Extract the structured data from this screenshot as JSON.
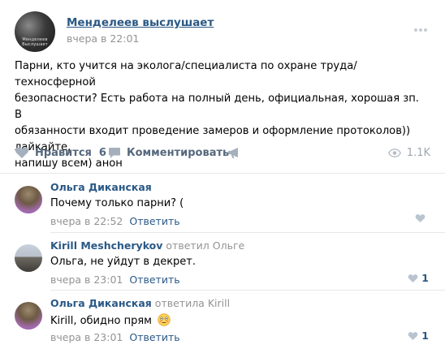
{
  "post": {
    "author": "Менделеев выслушает",
    "time": "вчера в 22:01",
    "avatar_text": "Менделеев Выслушает",
    "text": "Парни, кто учится на эколога/специалиста по охране труда/ техносферной\nбезопасности? Есть работа на полный день, официальная, хорошая зп. В\nобязанности входит проведение замеров и оформление протоколов)) лайкайте,\nнапишу всем) анон",
    "like_label": "Нравится",
    "like_count": "6",
    "comment_label": "Комментировать",
    "views": "1.1K"
  },
  "comments": [
    {
      "author": "Ольга Диканская",
      "replied_word": "",
      "reply_to": "",
      "text": "Почему только парни? (",
      "time": "вчера в 22:52",
      "reply_label": "Ответить",
      "likes": ""
    },
    {
      "author": "Kirill Meshcherykov",
      "replied_word": "ответил",
      "reply_to": "Ольге",
      "text": "Ольга, не уйдут в декрет.",
      "time": "вчера в 23:01",
      "reply_label": "Ответить",
      "likes": "1"
    },
    {
      "author": "Ольга Диканская",
      "replied_word": "ответила",
      "reply_to": "Kirill",
      "text": "Kirill, обидно прям",
      "time": "вчера в 23:01",
      "reply_label": "Ответить",
      "likes": "1"
    }
  ],
  "icons": {
    "more": "more-dots-icon",
    "like": "heart-icon",
    "comment": "comment-bubble-icon",
    "share": "megaphone-icon",
    "views": "eye-icon",
    "emoji": "flushed-face-emoji"
  },
  "colors": {
    "link": "#2a5885",
    "muted": "#939393",
    "action": "#55677d",
    "icon": "#a5b0bd",
    "divider": "#e7e8ec"
  }
}
